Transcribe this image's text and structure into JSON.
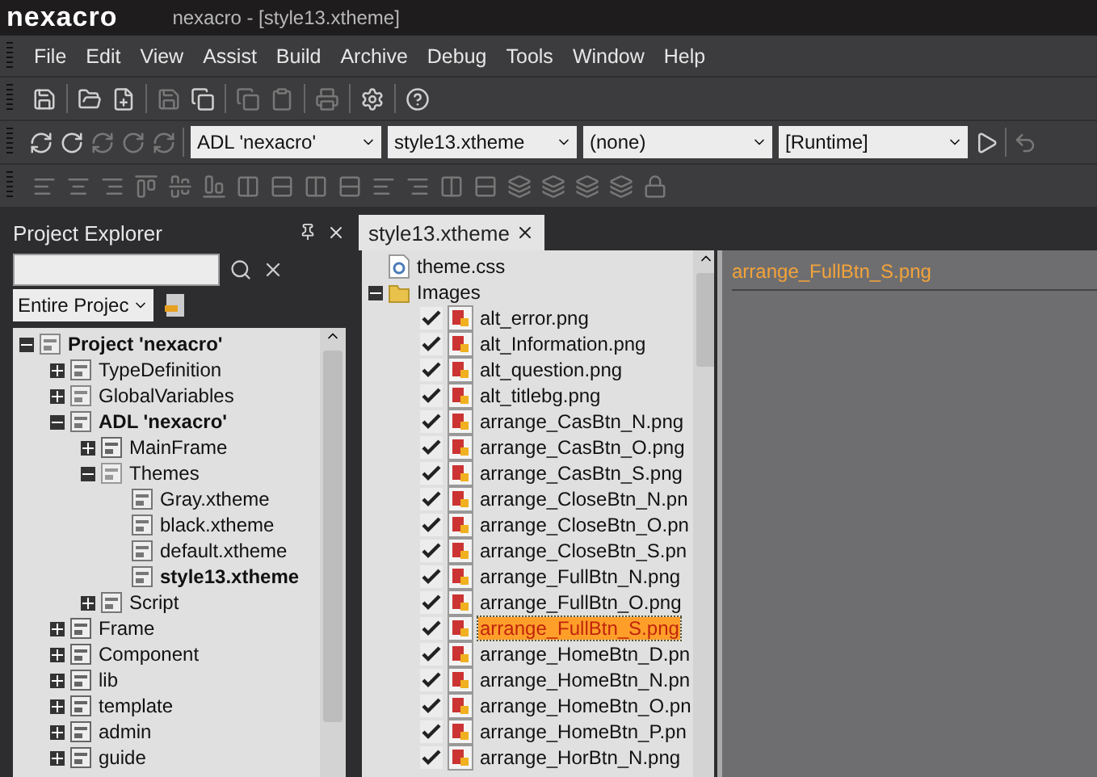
{
  "app": {
    "logo": "nexacro",
    "title": "nexacro - [style13.xtheme]"
  },
  "menu": [
    "File",
    "Edit",
    "View",
    "Assist",
    "Build",
    "Archive",
    "Debug",
    "Tools",
    "Window",
    "Help"
  ],
  "selectors": [
    {
      "value": "ADL 'nexacro'"
    },
    {
      "value": "style13.xtheme"
    },
    {
      "value": "(none)"
    },
    {
      "value": "[Runtime]"
    }
  ],
  "project_explorer": {
    "title": "Project Explorer",
    "scope": "Entire Projec",
    "tree": [
      {
        "label": "Project 'nexacro'",
        "kind": "project",
        "bold": true,
        "expanded": true,
        "children": [
          {
            "label": "TypeDefinition",
            "kind": "typedef",
            "bold": false,
            "expanded": false
          },
          {
            "label": "GlobalVariables",
            "kind": "globals",
            "bold": false,
            "expanded": false
          },
          {
            "label": "ADL 'nexacro'",
            "kind": "adl",
            "bold": true,
            "expanded": true,
            "children": [
              {
                "label": "MainFrame",
                "kind": "frame",
                "bold": false,
                "expanded": false
              },
              {
                "label": "Themes",
                "kind": "themes",
                "bold": false,
                "expanded": true,
                "children": [
                  {
                    "label": "Gray.xtheme",
                    "kind": "theme",
                    "bold": false
                  },
                  {
                    "label": "black.xtheme",
                    "kind": "theme",
                    "bold": false
                  },
                  {
                    "label": "default.xtheme",
                    "kind": "theme",
                    "bold": false
                  },
                  {
                    "label": "style13.xtheme",
                    "kind": "theme",
                    "bold": true
                  }
                ]
              },
              {
                "label": "Script",
                "kind": "script",
                "bold": false,
                "expanded": false
              }
            ]
          },
          {
            "label": "Frame",
            "kind": "group",
            "bold": false,
            "expanded": false
          },
          {
            "label": "Component",
            "kind": "group",
            "bold": false,
            "expanded": false
          },
          {
            "label": "lib",
            "kind": "group",
            "bold": false,
            "expanded": false
          },
          {
            "label": "template",
            "kind": "group",
            "bold": false,
            "expanded": false
          },
          {
            "label": "admin",
            "kind": "group",
            "bold": false,
            "expanded": false
          },
          {
            "label": "guide",
            "kind": "group",
            "bold": false,
            "expanded": false
          }
        ]
      }
    ]
  },
  "theme_editor": {
    "tab": {
      "label": "style13.xtheme",
      "selected": true
    },
    "tree": [
      {
        "label": "theme.css",
        "kind": "css"
      },
      {
        "label": "Images",
        "kind": "folder",
        "expanded": true,
        "children": [
          {
            "label": "alt_error.png",
            "kind": "image",
            "checked": true,
            "selected": false
          },
          {
            "label": "alt_Information.png",
            "kind": "image",
            "checked": true,
            "selected": false
          },
          {
            "label": "alt_question.png",
            "kind": "image",
            "checked": true,
            "selected": false
          },
          {
            "label": "alt_titlebg.png",
            "kind": "image",
            "checked": true,
            "selected": false
          },
          {
            "label": "arrange_CasBtn_N.png",
            "kind": "image",
            "checked": true,
            "selected": false
          },
          {
            "label": "arrange_CasBtn_O.png",
            "kind": "image",
            "checked": true,
            "selected": false
          },
          {
            "label": "arrange_CasBtn_S.png",
            "kind": "image",
            "checked": true,
            "selected": false
          },
          {
            "label": "arrange_CloseBtn_N.pn",
            "kind": "image",
            "checked": true,
            "selected": false
          },
          {
            "label": "arrange_CloseBtn_O.pn",
            "kind": "image",
            "checked": true,
            "selected": false
          },
          {
            "label": "arrange_CloseBtn_S.pn",
            "kind": "image",
            "checked": true,
            "selected": false
          },
          {
            "label": "arrange_FullBtn_N.png",
            "kind": "image",
            "checked": true,
            "selected": false
          },
          {
            "label": "arrange_FullBtn_O.png",
            "kind": "image",
            "checked": true,
            "selected": false
          },
          {
            "label": "arrange_FullBtn_S.png",
            "kind": "image",
            "checked": true,
            "selected": true
          },
          {
            "label": "arrange_HomeBtn_D.pn",
            "kind": "image",
            "checked": true,
            "selected": false
          },
          {
            "label": "arrange_HomeBtn_N.pn",
            "kind": "image",
            "checked": true,
            "selected": false
          },
          {
            "label": "arrange_HomeBtn_O.pn",
            "kind": "image",
            "checked": true,
            "selected": false
          },
          {
            "label": "arrange_HomeBtn_P.pn",
            "kind": "image",
            "checked": true,
            "selected": false
          },
          {
            "label": "arrange_HorBtn_N.png",
            "kind": "image",
            "checked": true,
            "selected": false
          }
        ]
      }
    ]
  },
  "preview": {
    "file_name": "arrange_FullBtn_S.png"
  }
}
